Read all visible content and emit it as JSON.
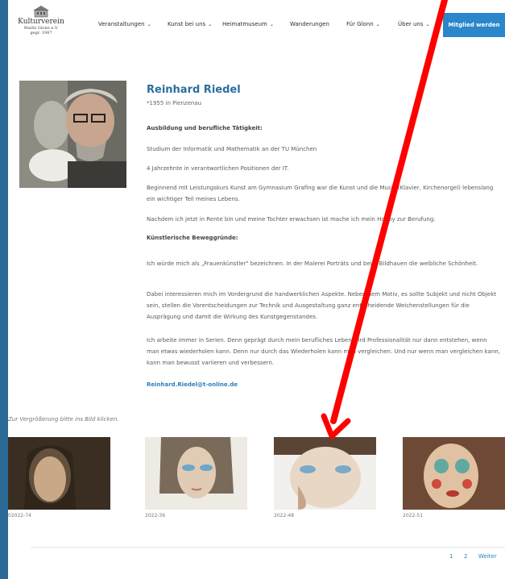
{
  "logo": {
    "title": "Kulturverein",
    "subtitle": "Markt Glonn e.V.",
    "year": "gegr. 1987"
  },
  "nav": [
    {
      "label": "Veranstaltungen",
      "has_menu": true
    },
    {
      "label": "Kunst bei uns",
      "has_menu": true
    },
    {
      "label": "Heimatmuseum",
      "has_menu": true
    },
    {
      "label": "Wanderungen",
      "has_menu": false
    },
    {
      "label": "Für Glonn",
      "has_menu": true
    },
    {
      "label": "Über uns",
      "has_menu": true
    }
  ],
  "member_button": "Mitglied werden",
  "artist": {
    "name": "Reinhard Riedel",
    "born": "*1955 in Pienzenau",
    "h_education": "Ausbildung und berufliche Tätigkeit:",
    "p1": "Studium der Informatik und Mathematik an der TU München",
    "p2": "4 Jahrzehnte in verantwortlichen Positionen der IT.",
    "p3": "Beginnend mit Leistungskurs Kunst am Gymnasium Grafing war die Kunst und die Musik (Klavier, Kirchenorgel) lebenslang ein wichtiger Teil meines Lebens.",
    "p4": "Nachdem ich jetzt in Rente bin und meine Tochter erwachsen ist mache ich mein Hobby zur Berufung.",
    "h_motives": "Künstlerische Beweggründe:",
    "p5": "Ich würde mich als „Frauenkünstler\" bezeichnen. In der Malerei Porträts und beim Bildhauen die weibliche Schönheit.",
    "p6": "Dabei interessieren mich im Vordergrund die handwerklichen Aspekte. Neben dem Motiv, es sollte Subjekt und nicht Objekt sein, stellen die Vorentscheidungen zur Technik und Ausgestaltung ganz entscheidende Weichenstellungen für die Ausprägung und damit die Wirkung des Kunstgegenstandes.",
    "p7": "Ich arbeite immer in Serien. Denn geprägt durch mein berufliches Leben wird Professionalität nur dann entstehen, wenn man etwas wiederholen kann. Denn nur durch das Wiederholen kann man vergleichen. Und nur wenn man vergleichen kann, kann man bewusst variieren und verbessern.",
    "email": "Reinhard.Riedel@t-online.de"
  },
  "gallery": {
    "note": "Zur Vergrößerung bitte ins Bild klicken.",
    "items": [
      {
        "caption": "02022-74"
      },
      {
        "caption": "2022-36"
      },
      {
        "caption": "2022-48"
      },
      {
        "caption": "2022-51"
      }
    ]
  },
  "pagination": {
    "p1": "1",
    "p2": "2",
    "next": "Weiter"
  },
  "colors": {
    "accent": "#2a6f9d",
    "button": "#2b86cc",
    "frame_bg": "#2c6a96",
    "arrow": "#ff0000"
  }
}
